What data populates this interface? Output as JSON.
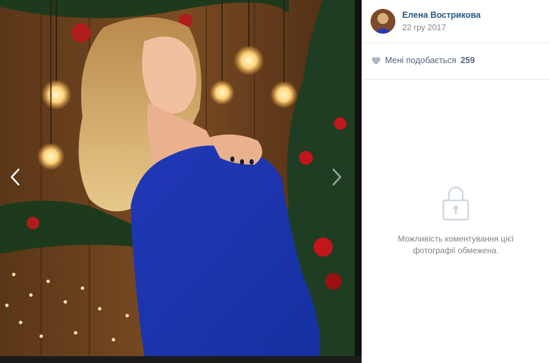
{
  "viewer": {
    "photo_alt": "",
    "prev_icon": "chevron-left-icon",
    "next_icon": "chevron-right-icon"
  },
  "sidebar": {
    "author_name": "Елена Вострикова",
    "post_date": "22 гру 2017",
    "like_icon": "heart-icon",
    "like_label": "Мені подобається",
    "like_count": "259",
    "comments_icon": "lock-icon",
    "comments_text": "Можливість коментування цієї фотографії обмежена."
  },
  "colors": {
    "link": "#2a5885",
    "muted": "#828282",
    "like": "#55677d",
    "divider": "#e7e8ec",
    "lock": "#d1d8e0"
  }
}
